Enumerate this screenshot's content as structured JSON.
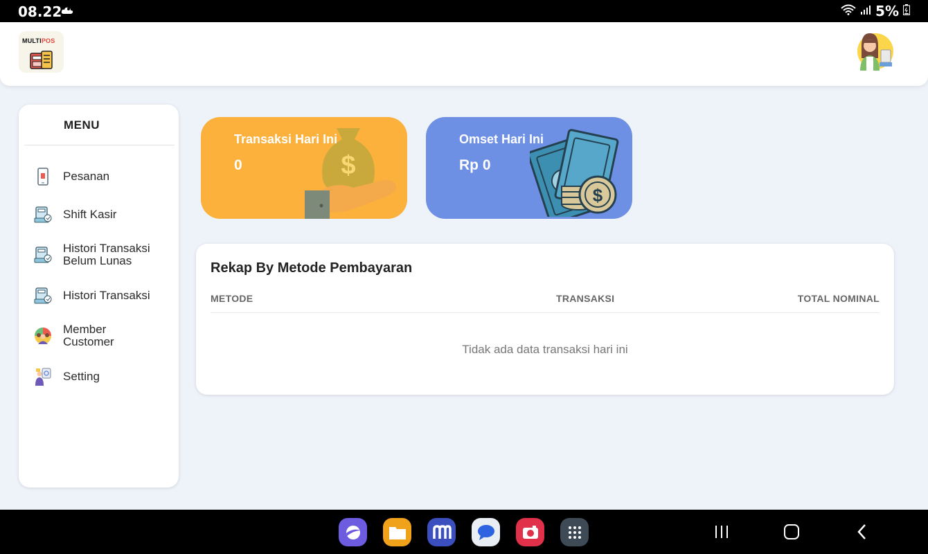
{
  "status_bar": {
    "time": "08.22",
    "battery": "5%",
    "icons": [
      "cloud-icon",
      "wifi-icon",
      "signal-icon",
      "battery-icon"
    ]
  },
  "header": {
    "logo_text_primary": "MULTI",
    "logo_text_accent": "POS",
    "avatar": "cashier-avatar"
  },
  "sidebar": {
    "title": "MENU",
    "items": [
      {
        "label": "Pesanan",
        "icon": "phone-order-icon"
      },
      {
        "label": "Shift Kasir",
        "icon": "cashier-register-icon"
      },
      {
        "label_line1": "Histori Transaksi",
        "label_line2": "Belum Lunas",
        "icon": "cashier-register-icon"
      },
      {
        "label": "Histori Transaksi",
        "icon": "cashier-register-icon"
      },
      {
        "label_line1": "Member",
        "label_line2": "Customer",
        "icon": "members-group-icon"
      },
      {
        "label": "Setting",
        "icon": "settings-person-icon"
      }
    ]
  },
  "cards": {
    "transactions": {
      "title": "Transaksi Hari Ini",
      "value": "0",
      "color": "#fbb13c",
      "icon": "money-bag-hand-icon"
    },
    "turnover": {
      "title": "Omset Hari Ini",
      "value": "Rp 0",
      "color": "#6d8fe4",
      "icon": "cash-coins-icon"
    }
  },
  "recap": {
    "title": "Rekap By Metode Pembayaran",
    "columns": [
      "METODE",
      "TRANSAKSI",
      "TOTAL NOMINAL"
    ],
    "empty_message": "Tidak ada data transaksi hari ini"
  },
  "navbar": {
    "apps": [
      "internet-app-icon",
      "files-app-icon",
      "multipos-app-icon",
      "messages-app-icon",
      "camera-app-icon",
      "app-drawer-icon"
    ],
    "buttons": [
      "recents-button",
      "home-button",
      "back-button"
    ]
  }
}
